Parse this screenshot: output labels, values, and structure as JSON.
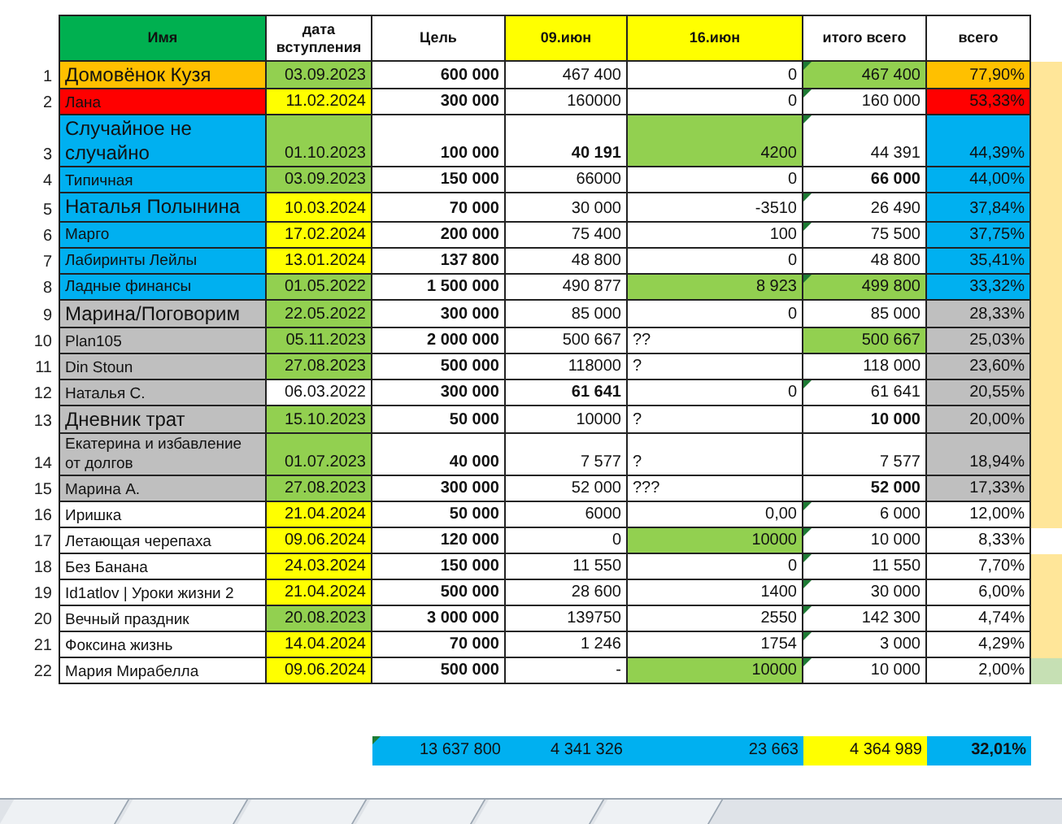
{
  "columns": [
    {
      "label": "Имя",
      "color": "#00b050"
    },
    {
      "label": "дата вступления"
    },
    {
      "label": "Цель"
    },
    {
      "label": "09.июн",
      "color": "#ffff00"
    },
    {
      "label": "16.июн",
      "color": "#ffff00"
    },
    {
      "label": "итого всего"
    },
    {
      "label": "всего"
    }
  ],
  "rows": [
    {
      "num": "1",
      "name": {
        "text": "Домовёнок Кузя",
        "color": "#ffc000",
        "large": true
      },
      "date": {
        "text": "03.09.2023",
        "color": "#92d050"
      },
      "goal": {
        "text": "600 000"
      },
      "jun09": {
        "text": "467 400"
      },
      "jun16": {
        "text": "0"
      },
      "total": {
        "text": "467 400",
        "color": "#92d050",
        "note": true
      },
      "pct": {
        "text": "77,90%",
        "color": "#ffc000"
      },
      "side": {
        "color": "#ffe699"
      }
    },
    {
      "num": "2",
      "name": {
        "text": "Лана",
        "color": "#ff0000"
      },
      "date": {
        "text": "11.02.2024",
        "color": "#ffff00"
      },
      "goal": {
        "text": "300 000"
      },
      "jun09": {
        "text": "160000"
      },
      "jun16": {
        "text": "0"
      },
      "total": {
        "text": "160 000",
        "note": true
      },
      "pct": {
        "text": "53,33%",
        "color": "#ff0000"
      },
      "side": {
        "color": "#ffe699"
      }
    },
    {
      "num": "3",
      "name": {
        "text": "Случайное не случайно",
        "color": "#00b0f0",
        "large": true
      },
      "date": {
        "text": "01.10.2023",
        "color": "#92d050"
      },
      "goal": {
        "text": "100 000"
      },
      "jun09": {
        "text": "40 191",
        "bold": true
      },
      "jun16": {
        "text": "4200",
        "color": "#92d050"
      },
      "total": {
        "text": "44 391",
        "note": true
      },
      "pct": {
        "text": "44,39%",
        "color": "#00b0f0"
      },
      "side": {
        "color": "#ffe699"
      }
    },
    {
      "num": "4",
      "name": {
        "text": "Типичная",
        "color": "#00b0f0"
      },
      "date": {
        "text": "03.09.2023",
        "color": "#92d050"
      },
      "goal": {
        "text": "150 000"
      },
      "jun09": {
        "text": "66000"
      },
      "jun16": {
        "text": "0"
      },
      "total": {
        "text": "66 000",
        "bold": true
      },
      "pct": {
        "text": "44,00%",
        "color": "#00b0f0"
      },
      "side": {
        "color": "#ffe699"
      }
    },
    {
      "num": "5",
      "name": {
        "text": "Наталья Полынина",
        "color": "#00b0f0",
        "large": true
      },
      "date": {
        "text": "10.03.2024",
        "color": "#ffff00"
      },
      "goal": {
        "text": "70 000"
      },
      "jun09": {
        "text": "30 000"
      },
      "jun16": {
        "text": "-3510"
      },
      "total": {
        "text": "26 490",
        "note": true
      },
      "pct": {
        "text": "37,84%",
        "color": "#00b0f0"
      },
      "side": {
        "color": "#ffe699"
      }
    },
    {
      "num": "6",
      "name": {
        "text": "Марго",
        "color": "#00b0f0"
      },
      "date": {
        "text": "17.02.2024",
        "color": "#ffff00"
      },
      "goal": {
        "text": "200 000"
      },
      "jun09": {
        "text": "75 400"
      },
      "jun16": {
        "text": "100"
      },
      "total": {
        "text": "75 500",
        "note": true
      },
      "pct": {
        "text": "37,75%",
        "color": "#00b0f0"
      },
      "side": {
        "color": "#ffe699"
      }
    },
    {
      "num": "7",
      "name": {
        "text": "Лабиринты Лейлы",
        "color": "#00b0f0"
      },
      "date": {
        "text": "13.01.2024",
        "color": "#ffff00"
      },
      "goal": {
        "text": "137 800"
      },
      "jun09": {
        "text": "48 800"
      },
      "jun16": {
        "text": "0"
      },
      "total": {
        "text": "48 800"
      },
      "pct": {
        "text": "35,41%",
        "color": "#00b0f0"
      },
      "side": {
        "color": "#ffe699"
      }
    },
    {
      "num": "8",
      "name": {
        "text": "Ладные финансы",
        "color": "#00b0f0"
      },
      "date": {
        "text": "01.05.2022",
        "color": "#92d050"
      },
      "goal": {
        "text": "1 500 000"
      },
      "jun09": {
        "text": "490 877"
      },
      "jun16": {
        "text": "8 923",
        "color": "#92d050"
      },
      "total": {
        "text": "499 800",
        "color": "#92d050",
        "note": true
      },
      "pct": {
        "text": "33,32%",
        "color": "#00b0f0"
      },
      "side": {
        "color": "#ffe699"
      }
    },
    {
      "num": "9",
      "name": {
        "text": "Марина/Поговорим",
        "color": "#bfbfbf",
        "large": true
      },
      "date": {
        "text": "22.05.2022",
        "color": "#92d050"
      },
      "goal": {
        "text": "300 000"
      },
      "jun09": {
        "text": "85 000"
      },
      "jun16": {
        "text": "0"
      },
      "total": {
        "text": "85 000"
      },
      "pct": {
        "text": "28,33%",
        "color": "#bfbfbf"
      },
      "side": {
        "color": "#ffe699"
      }
    },
    {
      "num": "10",
      "name": {
        "text": "Plan105",
        "color": "#bfbfbf"
      },
      "date": {
        "text": "05.11.2023",
        "color": "#92d050"
      },
      "goal": {
        "text": "2 000 000"
      },
      "jun09": {
        "text": "500 667"
      },
      "jun16": {
        "text": "??",
        "kind": "note"
      },
      "total": {
        "text": "500 667",
        "color": "#92d050"
      },
      "pct": {
        "text": "25,03%",
        "color": "#bfbfbf"
      },
      "side": {
        "color": "#ffe699"
      }
    },
    {
      "num": "11",
      "name": {
        "text": "Din Stoun",
        "color": "#bfbfbf"
      },
      "date": {
        "text": "27.08.2023",
        "color": "#92d050"
      },
      "goal": {
        "text": "500 000"
      },
      "jun09": {
        "text": "118000"
      },
      "jun16": {
        "text": "?",
        "kind": "note"
      },
      "total": {
        "text": "118 000"
      },
      "pct": {
        "text": "23,60%",
        "color": "#bfbfbf"
      },
      "side": {
        "color": "#ffe699"
      }
    },
    {
      "num": "12",
      "name": {
        "text": "Наталья С.",
        "color": "#bfbfbf"
      },
      "date": {
        "text": "06.03.2022"
      },
      "goal": {
        "text": "300 000"
      },
      "jun09": {
        "text": "61 641",
        "bold": true
      },
      "jun16": {
        "text": "0"
      },
      "total": {
        "text": "61 641",
        "note": true
      },
      "pct": {
        "text": "20,55%",
        "color": "#bfbfbf"
      },
      "side": {
        "color": "#ffe699"
      }
    },
    {
      "num": "13",
      "name": {
        "text": "Дневник трат",
        "color": "#bfbfbf",
        "large": true
      },
      "date": {
        "text": "15.10.2023",
        "color": "#92d050"
      },
      "goal": {
        "text": "50 000"
      },
      "jun09": {
        "text": "10000"
      },
      "jun16": {
        "text": "?",
        "kind": "note"
      },
      "total": {
        "text": "10 000",
        "bold": true
      },
      "pct": {
        "text": "20,00%",
        "color": "#bfbfbf"
      },
      "side": {
        "color": "#ffe699"
      }
    },
    {
      "num": "14",
      "name": {
        "text": "Екатерина и избавление от долгов",
        "color": "#bfbfbf"
      },
      "date": {
        "text": "01.07.2023",
        "color": "#92d050"
      },
      "goal": {
        "text": "40 000"
      },
      "jun09": {
        "text": "7 577"
      },
      "jun16": {
        "text": "?",
        "kind": "note"
      },
      "total": {
        "text": "7 577"
      },
      "pct": {
        "text": "18,94%",
        "color": "#bfbfbf"
      },
      "side": {
        "color": "#ffe699"
      }
    },
    {
      "num": "15",
      "name": {
        "text": "Марина А.",
        "color": "#bfbfbf"
      },
      "date": {
        "text": "27.08.2023",
        "color": "#92d050"
      },
      "goal": {
        "text": "300 000"
      },
      "jun09": {
        "text": "52 000"
      },
      "jun16": {
        "text": "???",
        "kind": "note"
      },
      "total": {
        "text": "52 000",
        "bold": true
      },
      "pct": {
        "text": "17,33%",
        "color": "#bfbfbf"
      },
      "side": {
        "color": "#ffe699"
      }
    },
    {
      "num": "16",
      "name": {
        "text": "Иришка"
      },
      "date": {
        "text": "21.04.2024",
        "color": "#ffff00"
      },
      "goal": {
        "text": "50 000"
      },
      "jun09": {
        "text": "6000"
      },
      "jun16": {
        "text": "0,00"
      },
      "total": {
        "text": "6 000",
        "note": true
      },
      "pct": {
        "text": "12,00%"
      },
      "side": {
        "color": "#ffe699"
      }
    },
    {
      "num": "17",
      "name": {
        "text": "Летающая черепаха"
      },
      "date": {
        "text": "09.06.2024",
        "color": "#ffff00"
      },
      "goal": {
        "text": "120 000"
      },
      "jun09": {
        "text": "0"
      },
      "jun16": {
        "text": "10000",
        "color": "#92d050"
      },
      "total": {
        "text": "10 000",
        "note": true
      },
      "pct": {
        "text": "8,33%"
      },
      "side": {}
    },
    {
      "num": "18",
      "name": {
        "text": "Без Банана"
      },
      "date": {
        "text": "24.03.2024",
        "color": "#ffff00"
      },
      "goal": {
        "text": "150 000"
      },
      "jun09": {
        "text": "11 550"
      },
      "jun16": {
        "text": "0"
      },
      "total": {
        "text": "11 550",
        "note": true
      },
      "pct": {
        "text": "7,70%"
      },
      "side": {
        "color": "#ffe699"
      }
    },
    {
      "num": "19",
      "name": {
        "text": "Id1atlov | Уроки жизни 2"
      },
      "date": {
        "text": "21.04.2024",
        "color": "#ffff00"
      },
      "goal": {
        "text": "500 000"
      },
      "jun09": {
        "text": "28 600"
      },
      "jun16": {
        "text": "1400"
      },
      "total": {
        "text": "30 000",
        "note": true
      },
      "pct": {
        "text": "6,00%"
      },
      "side": {
        "color": "#ffe699"
      }
    },
    {
      "num": "20",
      "name": {
        "text": "Вечный праздник"
      },
      "date": {
        "text": "20.08.2023",
        "color": "#92d050"
      },
      "goal": {
        "text": "3 000 000"
      },
      "jun09": {
        "text": "139750"
      },
      "jun16": {
        "text": "2550"
      },
      "total": {
        "text": "142 300",
        "note": true
      },
      "pct": {
        "text": "4,74%"
      },
      "side": {
        "color": "#ffe699"
      }
    },
    {
      "num": "21",
      "name": {
        "text": "Фоксина жизнь"
      },
      "date": {
        "text": "14.04.2024",
        "color": "#ffff00"
      },
      "goal": {
        "text": "70 000"
      },
      "jun09": {
        "text": "1 246"
      },
      "jun16": {
        "text": "1754"
      },
      "total": {
        "text": "3 000",
        "note": true
      },
      "pct": {
        "text": "4,29%"
      },
      "side": {
        "color": "#ffe699"
      }
    },
    {
      "num": "22",
      "name": {
        "text": "Мария Мирабелла"
      },
      "date": {
        "text": "09.06.2024",
        "color": "#ffff00"
      },
      "goal": {
        "text": "500 000"
      },
      "jun09": {
        "text": "-"
      },
      "jun16": {
        "text": "10000",
        "color": "#92d050"
      },
      "total": {
        "text": "10 000",
        "note": true
      },
      "pct": {
        "text": "2,00%"
      },
      "side": {
        "color": "#c6e0b4"
      }
    }
  ],
  "totals": {
    "goal": {
      "text": "13 637 800",
      "color": "#00b0f0",
      "note": true
    },
    "jun09": {
      "text": "4 341 326",
      "color": "#00b0f0"
    },
    "jun16": {
      "text": "23 663",
      "color": "#00b0f0"
    },
    "total": {
      "text": "4 364 989",
      "color": "#ffff00"
    },
    "pct": {
      "text": "32,01%",
      "color": "#00b0f0"
    }
  }
}
